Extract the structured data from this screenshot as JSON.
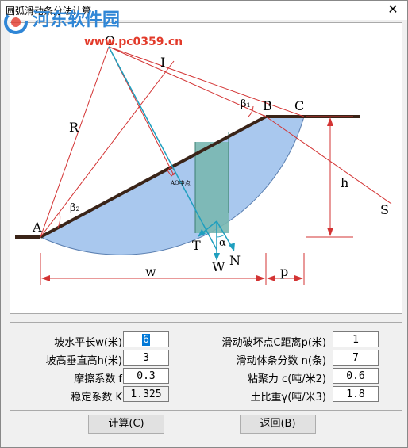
{
  "window": {
    "title": "圆弧滑动条分法计算",
    "close_glyph": "✕"
  },
  "watermark": {
    "brand": "河东软件园",
    "url": "www.pc0359.cn",
    "logo": "swirl-logo-icon"
  },
  "diagram": {
    "labels": {
      "O": "O",
      "I": "I",
      "R": "R",
      "B": "B",
      "C": "C",
      "A": "A",
      "beta1": "β₁",
      "beta2": "β₂",
      "h": "h",
      "S": "S",
      "T": "T",
      "W": "W",
      "N": "N",
      "alpha": "α",
      "w": "w",
      "p": "p",
      "ao_mid": "AO中点"
    },
    "colors": {
      "sliding_body": "#a9c8ee",
      "slice": "#79b7b0",
      "line": "#d33333",
      "slope": "#3a2418",
      "force": "#1f9fbf"
    }
  },
  "form": {
    "rows": [
      {
        "left_label": "坡水平长w(米)",
        "left_value": "6",
        "right_label": "滑动破坏点C距离p(米)",
        "right_value": "1"
      },
      {
        "left_label": "坡高垂直高h(米)",
        "left_value": "3",
        "right_label": "滑动体条分数 n(条)",
        "right_value": "7"
      },
      {
        "left_label": "摩擦系数 f",
        "left_value": "0.3",
        "right_label": "粘聚力 c(吨/米2)",
        "right_value": "0.6"
      },
      {
        "left_label": "稳定系数 K",
        "left_value": "1.325",
        "right_label": "土比重γ(吨/米3)",
        "right_value": "1.8"
      }
    ]
  },
  "buttons": {
    "calc": "计算(C)",
    "back": "返回(B)"
  }
}
